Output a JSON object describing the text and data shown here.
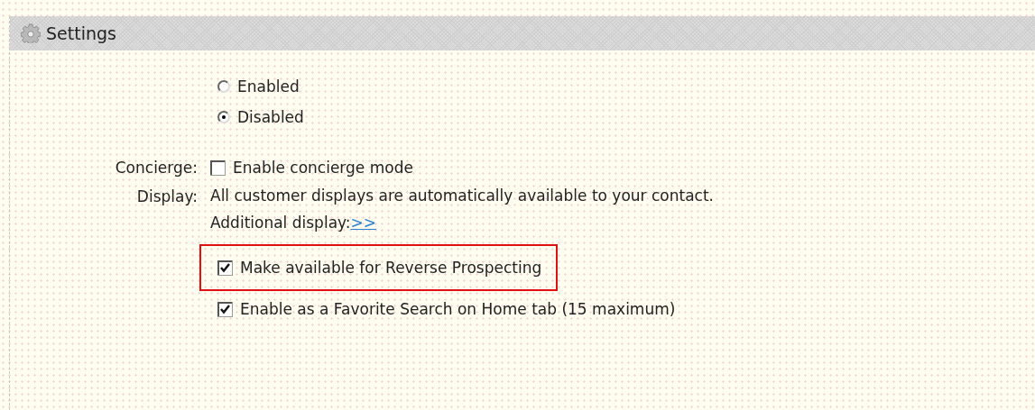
{
  "panel": {
    "title": "Settings"
  },
  "status_options": [
    {
      "label": "Enabled",
      "selected": false
    },
    {
      "label": "Disabled",
      "selected": true
    }
  ],
  "concierge": {
    "label": "Concierge:",
    "option": "Enable concierge mode",
    "checked": false
  },
  "display": {
    "label": "Display:",
    "note": "All customer displays are automatically available to your contact.",
    "additional_label": "Additional display:",
    "additional_link": ">>"
  },
  "options": [
    {
      "label": "Make available for Reverse Prospecting",
      "checked": true,
      "highlighted": true
    },
    {
      "label": "Enable as a Favorite Search on Home tab (15 maximum)",
      "checked": true,
      "highlighted": false
    }
  ]
}
